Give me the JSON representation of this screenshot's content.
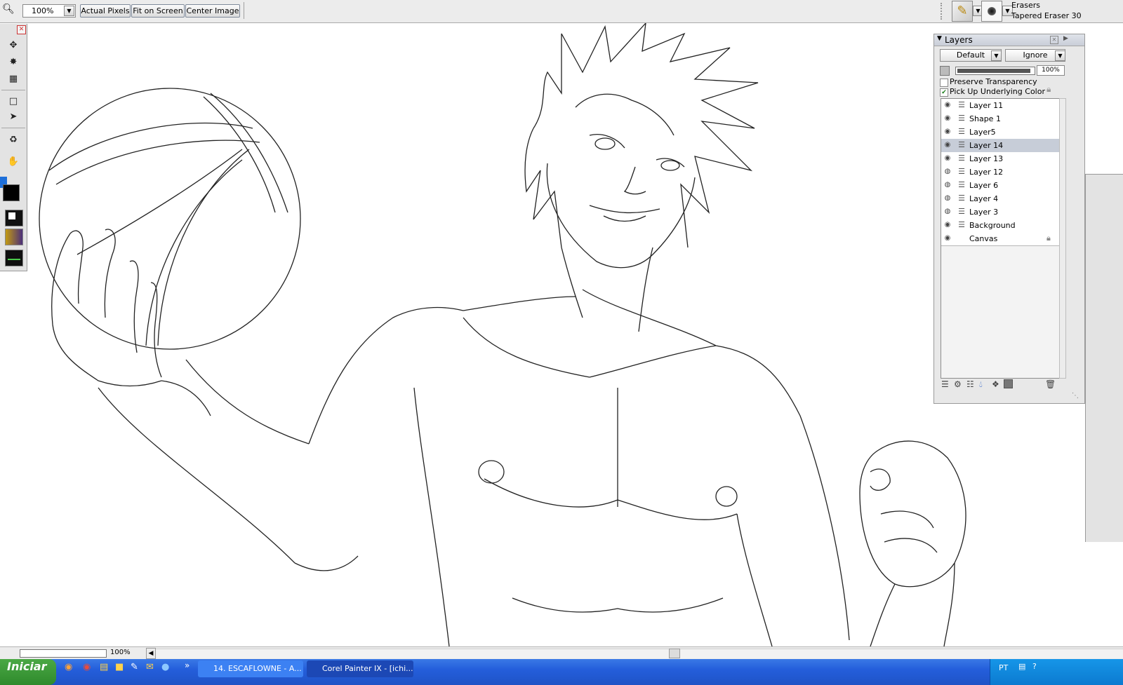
{
  "toolbar": {
    "zoom_value": "100%",
    "actual_pixels_label": "Actual Pixels",
    "fit_on_screen_label": "Fit on Screen",
    "center_image_label": "Center Image"
  },
  "brush": {
    "category": "Erasers",
    "variant": "Tapered Eraser 30"
  },
  "layers_panel": {
    "title": "Layers",
    "composite_method": "Default",
    "depth": "Ignore",
    "opacity": "100%",
    "preserve_transparency_label": "Preserve Transparency",
    "pick_up_underlying_color_label": "Pick Up Underlying Color",
    "preserve_transparency_checked": false,
    "pick_up_underlying_color_checked": true,
    "layers": [
      {
        "name": "Layer 11",
        "selected": false
      },
      {
        "name": "Shape 1",
        "selected": false
      },
      {
        "name": "Layer5",
        "selected": false
      },
      {
        "name": "Layer 14",
        "selected": true
      },
      {
        "name": "Layer 13",
        "selected": false
      },
      {
        "name": "Layer 12",
        "selected": false
      },
      {
        "name": "Layer 6",
        "selected": false
      },
      {
        "name": "Layer 4",
        "selected": false
      },
      {
        "name": "Layer 3",
        "selected": false
      },
      {
        "name": "Background",
        "selected": false
      },
      {
        "name": "Canvas",
        "selected": false
      }
    ]
  },
  "status_bar": {
    "zoom": "100%"
  },
  "taskbar": {
    "start_label": "Iniciar",
    "tasks": [
      "14. ESCAFLOWNE - A...",
      "Corel Painter IX - [ichi..."
    ],
    "language": "PT"
  },
  "colors": {
    "main_color": "#1e6fd9",
    "additional_color": "#000000",
    "selected_layer": "#c7cdd8",
    "taskbar": "#245edb",
    "start_button": "#3a9a37"
  }
}
